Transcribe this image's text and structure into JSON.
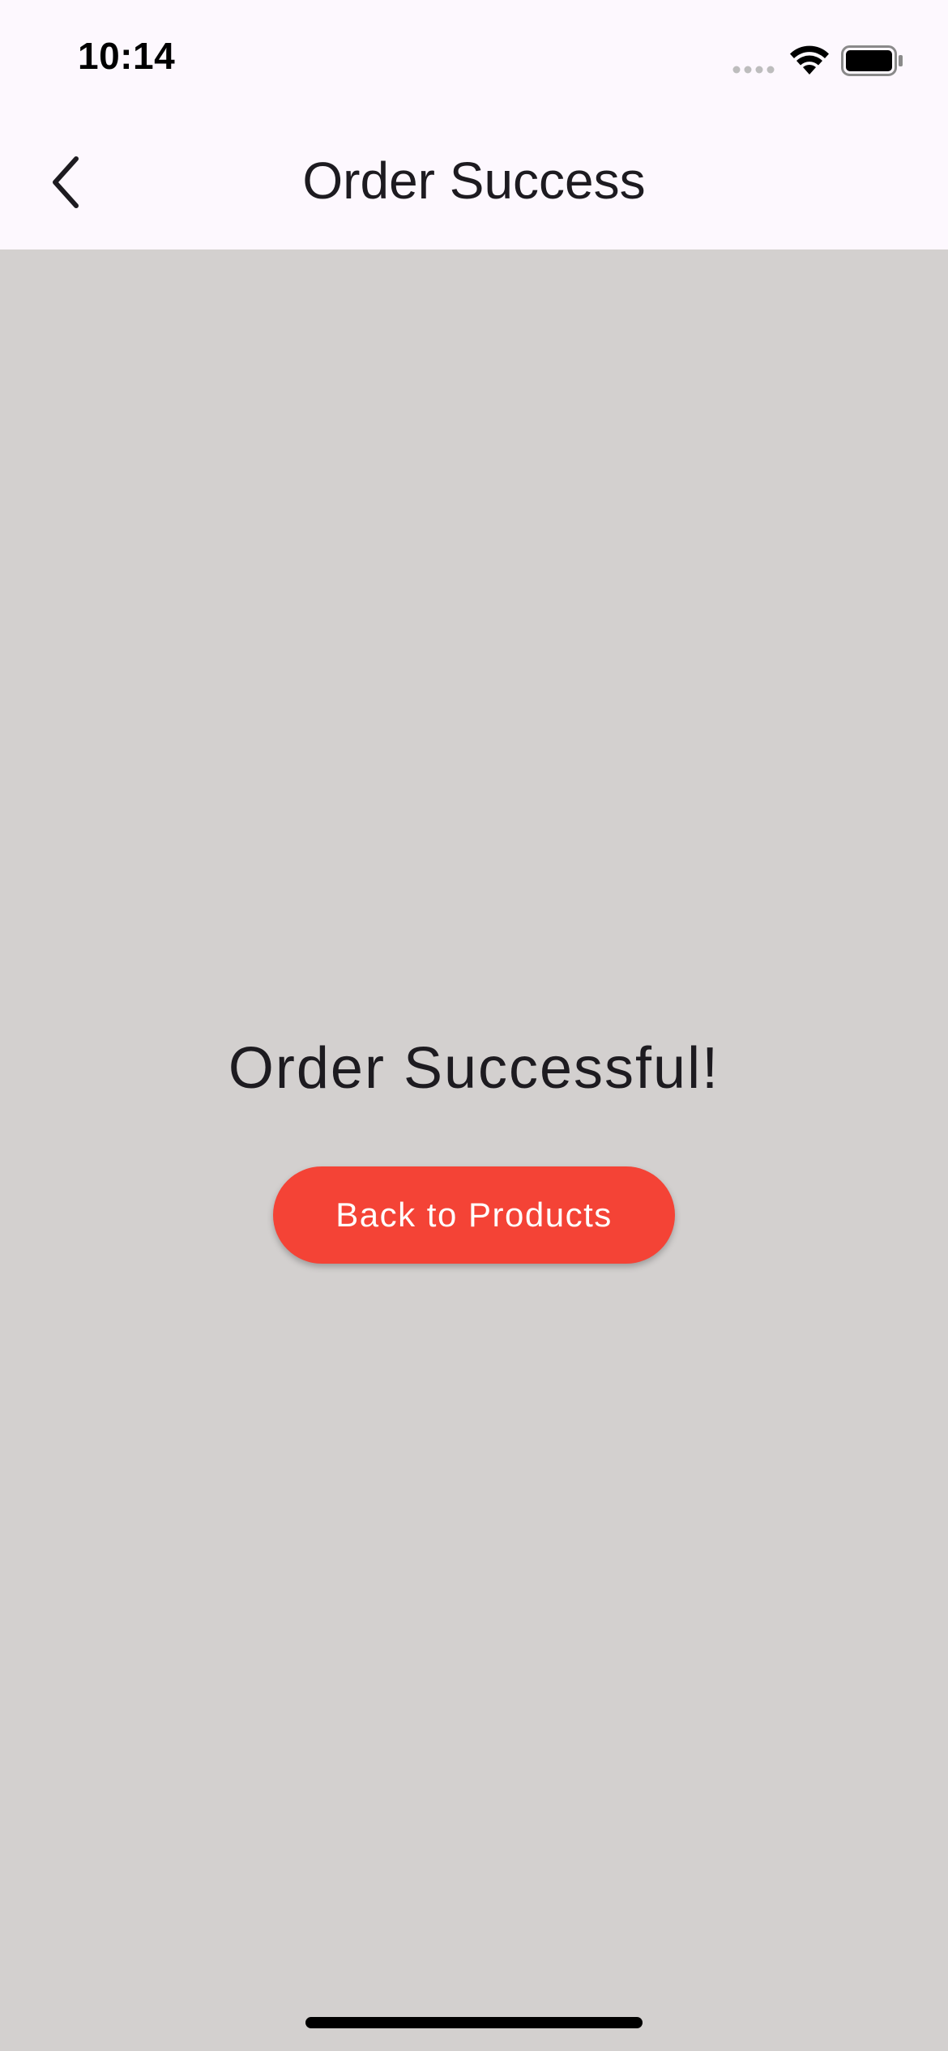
{
  "status_bar": {
    "time": "10:14",
    "icons": [
      "cellular-signal-icon",
      "wifi-icon",
      "battery-icon"
    ]
  },
  "app_bar": {
    "title": "Order Success",
    "back_icon": "chevron-left-icon"
  },
  "main": {
    "message": "Order Successful!",
    "button_label": "Back to Products"
  },
  "colors": {
    "surface": "#fdf8fe",
    "background": "#d3d0cf",
    "primary_button": "#f44336",
    "text": "#1d1b20"
  }
}
